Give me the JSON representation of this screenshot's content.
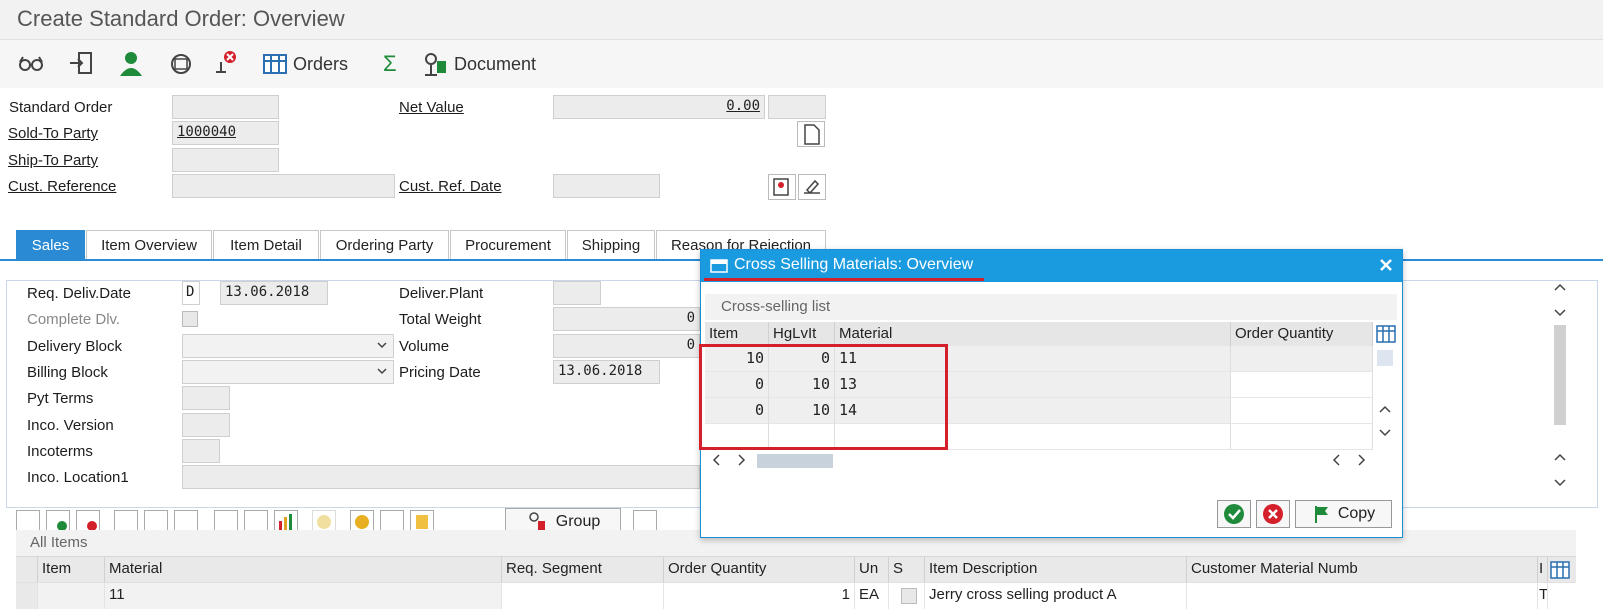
{
  "window": {
    "title": "Create Standard Order: Overview"
  },
  "toolbar": {
    "orders_label": "Orders",
    "document_label": "Document",
    "icons": [
      "glasses-icon",
      "exit-icon",
      "person-icon",
      "conditions-icon",
      "delete-icon",
      "orders-table-icon",
      "sigma-icon",
      "document-icon"
    ]
  },
  "header": {
    "standard_order_label": "Standard Order",
    "standard_order_value": "",
    "net_value_label": "Net Value",
    "net_value_value": "0.00",
    "sold_to_label": "Sold-To Party",
    "sold_to_value": "1000040",
    "ship_to_label": "Ship-To Party",
    "ship_to_value": "",
    "cust_ref_label": "Cust. Reference",
    "cust_ref_value": "",
    "cust_ref_date_label": "Cust. Ref. Date",
    "cust_ref_date_value": ""
  },
  "tabs": [
    {
      "label": "Sales",
      "active": true
    },
    {
      "label": "Item Overview"
    },
    {
      "label": "Item Detail"
    },
    {
      "label": "Ordering Party"
    },
    {
      "label": "Procurement"
    },
    {
      "label": "Shipping"
    },
    {
      "label": "Reason for Rejection"
    }
  ],
  "sales": {
    "req_deliv_date_label": "Req. Deliv.Date",
    "req_deliv_date_type": "D",
    "req_deliv_date_value": "13.06.2018",
    "complete_dlv_label": "Complete Dlv.",
    "delivery_block_label": "Delivery Block",
    "billing_block_label": "Billing Block",
    "pyt_terms_label": "Pyt Terms",
    "inco_version_label": "Inco. Version",
    "incoterms_label": "Incoterms",
    "inco_location_label": "Inco. Location1",
    "deliver_plant_label": "Deliver.Plant",
    "total_weight_label": "Total Weight",
    "total_weight_value": "0",
    "volume_label": "Volume",
    "volume_value": "0",
    "pricing_date_label": "Pricing Date",
    "pricing_date_value": "13.06.2018"
  },
  "items": {
    "group_label": "Group",
    "section_title": "All Items",
    "columns": [
      "Item",
      "Material",
      "Req. Segment",
      "Order Quantity",
      "Un",
      "S",
      "Item Description",
      "Customer Material Numb",
      "I"
    ],
    "rows": [
      {
        "item": "",
        "material": "11",
        "req_segment": "",
        "order_qty": "1",
        "unit": "EA",
        "s": "",
        "description": "Jerry cross selling product A",
        "customer_material": "",
        "i": "T"
      }
    ]
  },
  "dialog": {
    "title": "Cross Selling Materials: Overview",
    "grid_title": "Cross-selling list",
    "columns": [
      "Item",
      "HgLvIt",
      "Material",
      "Order Quantity"
    ],
    "rows": [
      {
        "item": "10",
        "hglvit": "0",
        "material": "11",
        "order_qty": ""
      },
      {
        "item": "0",
        "hglvit": "10",
        "material": "13",
        "order_qty": ""
      },
      {
        "item": "0",
        "hglvit": "10",
        "material": "14",
        "order_qty": ""
      }
    ],
    "copy_label": "Copy"
  },
  "colors": {
    "accent": "#1a9be0",
    "tab_active": "#2a8ad4",
    "highlight": "#d3202a"
  }
}
